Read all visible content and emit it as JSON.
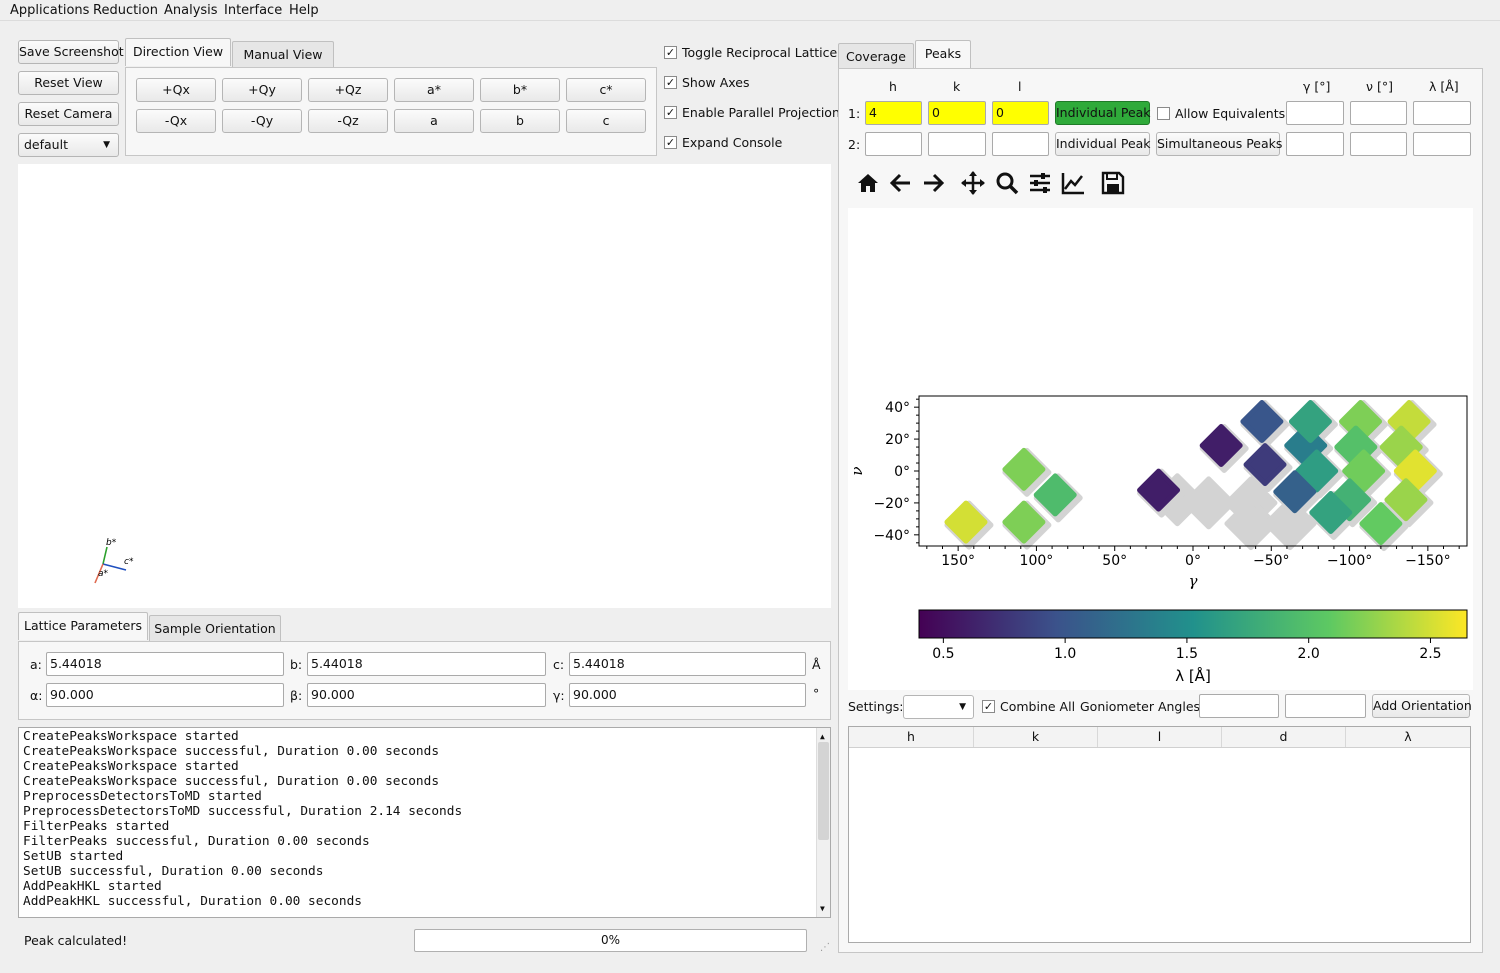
{
  "menu": [
    "Applications",
    "Reduction",
    "Analysis",
    "Interface",
    "Help"
  ],
  "left_buttons": {
    "save_screenshot": "Save Screenshot",
    "reset_view": "Reset View",
    "reset_camera": "Reset Camera",
    "preset": "default"
  },
  "view_tabs": [
    "Direction View",
    "Manual View"
  ],
  "direction_buttons_row1": [
    "+Qx",
    "+Qy",
    "+Qz",
    "a*",
    "b*",
    "c*"
  ],
  "direction_buttons_row2": [
    "-Qx",
    "-Qy",
    "-Qz",
    "a",
    "b",
    "c"
  ],
  "options": [
    {
      "label": "Toggle Reciprocal Lattice",
      "checked": true
    },
    {
      "label": "Show Axes",
      "checked": true
    },
    {
      "label": "Enable Parallel Projection",
      "checked": true
    },
    {
      "label": "Expand Console",
      "checked": true
    }
  ],
  "axes_triad": {
    "b": "b*",
    "c": "c*",
    "a": "a*"
  },
  "lattice_tabs": [
    "Lattice Parameters",
    "Sample Orientation"
  ],
  "lattice": {
    "a_label": "a:",
    "a": "5.44018",
    "b_label": "b:",
    "b": "5.44018",
    "c_label": "c:",
    "c": "5.44018",
    "length_unit": "Å",
    "alpha_label": "α:",
    "alpha": "90.000",
    "beta_label": "β:",
    "beta": "90.000",
    "gamma_label": "γ:",
    "gamma": "90.000",
    "angle_unit": "°"
  },
  "console_lines": [
    "CreatePeaksWorkspace started",
    "CreatePeaksWorkspace successful, Duration 0.00 seconds",
    "CreatePeaksWorkspace started",
    "CreatePeaksWorkspace successful, Duration 0.00 seconds",
    "PreprocessDetectorsToMD started",
    "PreprocessDetectorsToMD successful, Duration 2.14 seconds",
    "FilterPeaks started",
    "FilterPeaks successful, Duration 0.00 seconds",
    "SetUB started",
    "SetUB successful, Duration 0.00 seconds",
    "AddPeakHKL started",
    "AddPeakHKL successful, Duration 0.00 seconds"
  ],
  "status": {
    "message": "Peak calculated!",
    "progress_text": "0%",
    "progress": 0
  },
  "right_tabs": [
    "Coverage",
    "Peaks"
  ],
  "peaks_header": {
    "h": "h",
    "k": "k",
    "l": "l",
    "gamma": "γ [°]",
    "nu": "ν [°]",
    "lambda": "λ [Å]"
  },
  "row1": {
    "label": "1:",
    "h": "4",
    "k": "0",
    "l": "0",
    "button": "Individual Peak",
    "allow_equivalents": "Allow Equivalents",
    "allow_checked": false,
    "gamma": "",
    "nu": "",
    "lambda": ""
  },
  "row2": {
    "label": "2:",
    "h": "",
    "k": "",
    "l": "",
    "button": "Individual Peak",
    "button2": "Simultaneous Peaks",
    "gamma": "",
    "nu": "",
    "lambda": ""
  },
  "toolbar_icons": [
    "home-icon",
    "back-arrow-icon",
    "forward-arrow-icon",
    "pan-icon",
    "zoom-icon",
    "configure-subplots-icon",
    "edit-axis-icon",
    "save-icon"
  ],
  "chart_data": {
    "type": "heatmap",
    "xlabel": "γ",
    "ylabel": "ν",
    "x_ticks": [
      "150°",
      "100°",
      "50°",
      "0°",
      "−50°",
      "−100°",
      "−150°"
    ],
    "y_ticks": [
      "40°",
      "20°",
      "0°",
      "−20°",
      "−40°"
    ],
    "x_tick_values": [
      150,
      100,
      50,
      0,
      -50,
      -100,
      -150
    ],
    "y_tick_values": [
      40,
      20,
      0,
      -20,
      -40
    ],
    "xlim": [
      175,
      -175
    ],
    "ylim": [
      -47,
      47
    ],
    "colorbar": {
      "label": "λ [Å]",
      "ticks": [
        "0.5",
        "1.0",
        "1.5",
        "2.0",
        "2.5"
      ],
      "tick_values": [
        0.5,
        1.0,
        1.5,
        2.0,
        2.5
      ],
      "range": [
        0.4,
        2.65
      ],
      "colormap": "viridis"
    },
    "coverage_patches": [
      {
        "gamma": 145,
        "nu": -32,
        "lambda": 2.5
      },
      {
        "gamma": 108,
        "nu": 1,
        "lambda": 2.2
      },
      {
        "gamma": 108,
        "nu": -32,
        "lambda": 2.2
      },
      {
        "gamma": 88,
        "nu": -15,
        "lambda": 1.95
      },
      {
        "gamma": -18,
        "nu": 16,
        "lambda": 0.6
      },
      {
        "gamma": -44,
        "nu": 31,
        "lambda": 1.0
      },
      {
        "gamma": -46,
        "nu": 4,
        "lambda": 0.8
      },
      {
        "gamma": -72,
        "nu": 16,
        "lambda": 1.35
      },
      {
        "gamma": -75,
        "nu": 31,
        "lambda": 1.7
      },
      {
        "gamma": -79,
        "nu": 0,
        "lambda": 1.65
      },
      {
        "gamma": -65,
        "nu": -13,
        "lambda": 1.1
      },
      {
        "gamma": -107,
        "nu": 31,
        "lambda": 2.2
      },
      {
        "gamma": -104,
        "nu": 15,
        "lambda": 2.0
      },
      {
        "gamma": -109,
        "nu": 0,
        "lambda": 2.15
      },
      {
        "gamma": -100,
        "nu": -18,
        "lambda": 1.85
      },
      {
        "gamma": -88,
        "nu": -26,
        "lambda": 1.7
      },
      {
        "gamma": -138,
        "nu": 31,
        "lambda": 2.45
      },
      {
        "gamma": -133,
        "nu": 15,
        "lambda": 2.3
      },
      {
        "gamma": -142,
        "nu": 0,
        "lambda": 2.55
      },
      {
        "gamma": -136,
        "nu": -18,
        "lambda": 2.3
      },
      {
        "gamma": -120,
        "nu": -33,
        "lambda": 2.1
      },
      {
        "gamma": 22,
        "nu": -12,
        "lambda": 0.6
      }
    ],
    "gray_regions": [
      {
        "gamma": -10,
        "nu": -20
      },
      {
        "gamma": -37,
        "nu": -20
      },
      {
        "gamma": -37,
        "nu": -33
      },
      {
        "gamma": -62,
        "nu": -33
      },
      {
        "gamma": 10,
        "nu": -18
      }
    ]
  },
  "bottom": {
    "settings_label": "Settings:",
    "combine_all": "Combine All",
    "combine_checked": true,
    "goniometer_label": "Goniometer Angles:",
    "add_orientation": "Add Orientation"
  },
  "table_headers": [
    "h",
    "k",
    "l",
    "d",
    "λ"
  ]
}
